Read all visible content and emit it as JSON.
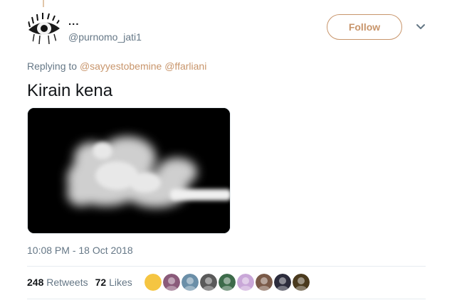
{
  "tweet": {
    "display_name": "...",
    "username": "@purnomo_jati1",
    "follow_label": "Follow",
    "replying_prefix": "Replying to",
    "mentions": [
      "@sayyestobemine",
      "@ffarliani"
    ],
    "text": "Kirain kena",
    "timestamp": "10:08 PM - 18 Oct 2018",
    "retweets_count": "248",
    "retweets_label": "Retweets",
    "likes_count": "72",
    "likes_label": "Likes"
  },
  "colors": {
    "accent": "#c8956b",
    "secondary_text": "#657786"
  },
  "likers": [
    {
      "name": "liker-avatar",
      "color": "#f5c542"
    },
    {
      "name": "liker-avatar",
      "color": "#8a5a7a"
    },
    {
      "name": "liker-avatar",
      "color": "#6b8fa8"
    },
    {
      "name": "liker-avatar",
      "color": "#5a5a5a"
    },
    {
      "name": "liker-avatar",
      "color": "#3d6b4a"
    },
    {
      "name": "liker-avatar",
      "color": "#c9a7d8"
    },
    {
      "name": "liker-avatar",
      "color": "#7a5a48"
    },
    {
      "name": "liker-avatar",
      "color": "#2c2c3c"
    },
    {
      "name": "liker-avatar",
      "color": "#4a3a1e"
    }
  ]
}
